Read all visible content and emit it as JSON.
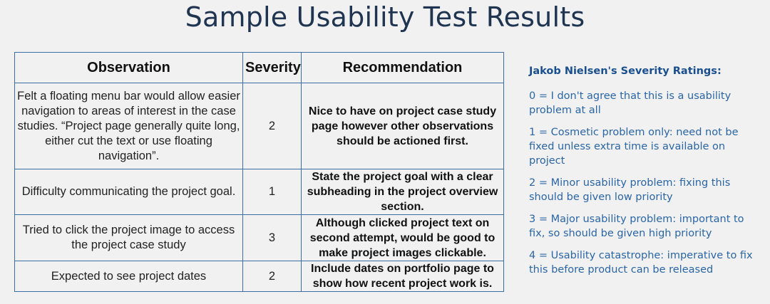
{
  "title": "Sample Usability Test Results",
  "table": {
    "headers": [
      "Observation",
      "Severity",
      "Recommendation"
    ],
    "rows": [
      {
        "observation": "Felt a floating menu bar would allow easier navigation to areas of interest in the case studies. “Project page generally quite long, either cut the text or use floating navigation”.",
        "severity": "2",
        "recommendation": "Nice to have on project case study page however other observations should be actioned first."
      },
      {
        "observation": "Difficulty communicating the project goal.",
        "severity": "1",
        "recommendation": "State the project goal with a clear subheading in the project overview section."
      },
      {
        "observation": "Tried to click the project image to access the project case study",
        "severity": "3",
        "recommendation": "Although clicked project text on second attempt, would be good to make project images clickable."
      },
      {
        "observation": "Expected to see project dates",
        "severity": "2",
        "recommendation": "Include dates on portfolio page to show how recent project work is."
      }
    ]
  },
  "ratings": {
    "heading": "Jakob Nielsen's Severity Ratings:",
    "items": [
      "0 = I don't agree that this is a usability problem at all",
      "1 = Cosmetic problem only: need not be fixed unless extra time is available on project",
      "2 = Minor usability problem: fixing this should be given low priority",
      "3 = Major usability problem: important to fix, so should be given high priority",
      "4 = Usability catastrophe: imperative to fix this before product can be released"
    ]
  },
  "colors": {
    "background": "#f1f1f1",
    "title": "#1f3450",
    "table_border": "#3a6ea5",
    "ratings_text": "#2a65a6"
  }
}
